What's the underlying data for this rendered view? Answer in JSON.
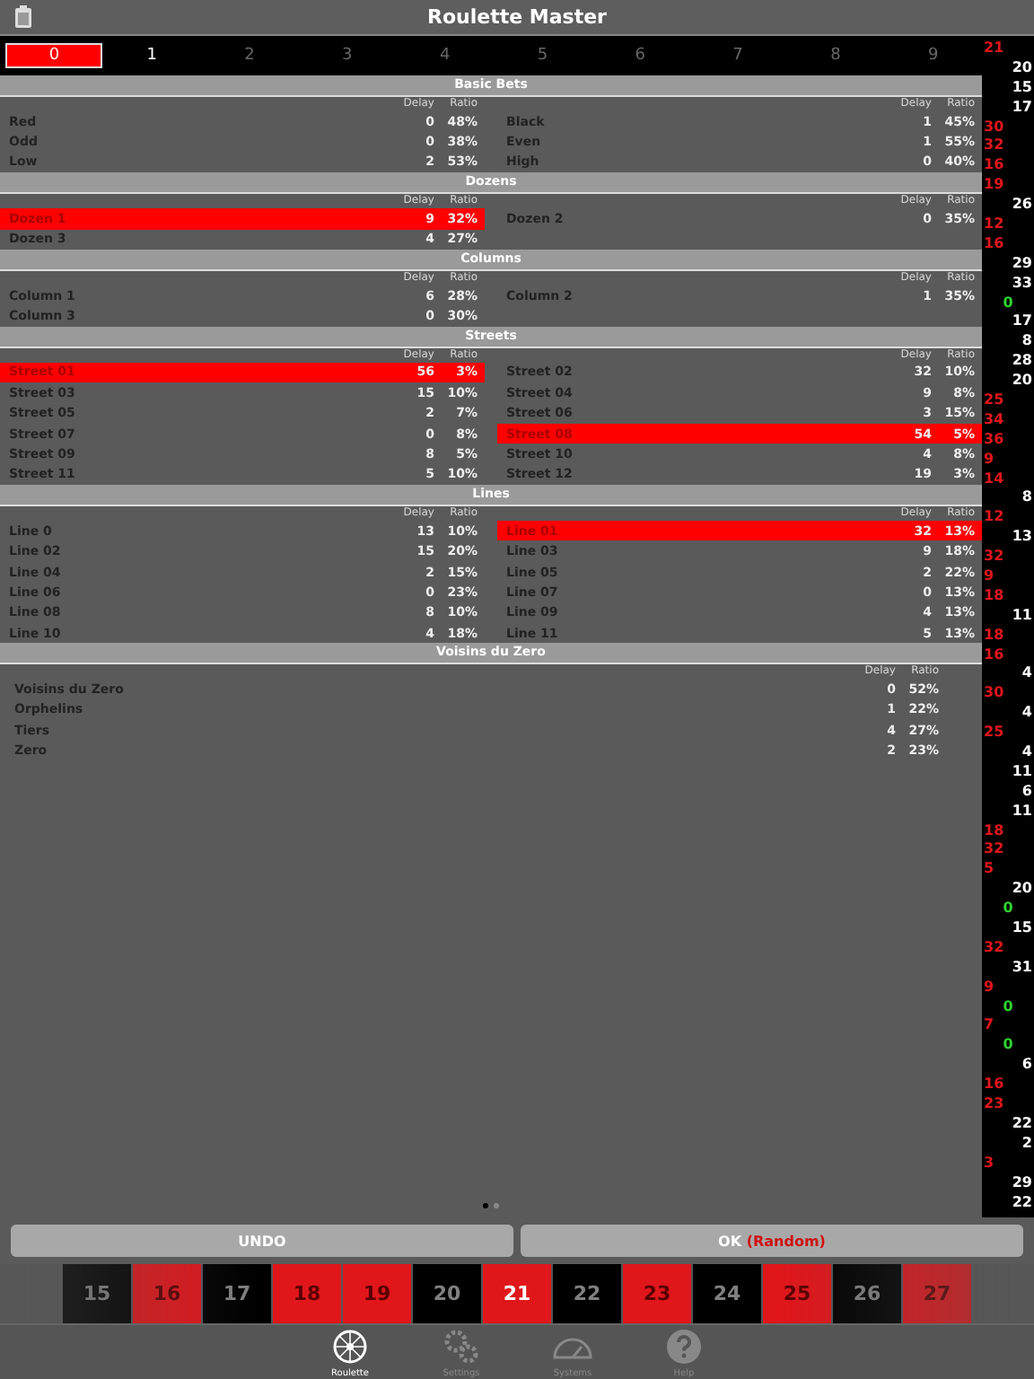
{
  "window": {
    "title": "Roulette Master"
  },
  "digits": [
    {
      "label": "0",
      "selected": true,
      "enabled": true
    },
    {
      "label": "1",
      "selected": false,
      "enabled": true
    },
    {
      "label": "2",
      "selected": false,
      "enabled": false
    },
    {
      "label": "3",
      "selected": false,
      "enabled": false
    },
    {
      "label": "4",
      "selected": false,
      "enabled": false
    },
    {
      "label": "5",
      "selected": false,
      "enabled": false
    },
    {
      "label": "6",
      "selected": false,
      "enabled": false
    },
    {
      "label": "7",
      "selected": false,
      "enabled": false
    },
    {
      "label": "8",
      "selected": false,
      "enabled": false
    },
    {
      "label": "9",
      "selected": false,
      "enabled": false
    }
  ],
  "sections": [
    {
      "title": "Basic Bets",
      "kind": "two_column",
      "columns": [
        {
          "delay_label": "Delay",
          "ratio_label": "Ratio",
          "rows": [
            {
              "label": "Red",
              "delay": "0",
              "ratio": "48%",
              "highlighted": false
            },
            {
              "label": "Odd",
              "delay": "0",
              "ratio": "38%",
              "highlighted": false
            },
            {
              "label": "Low",
              "delay": "2",
              "ratio": "53%",
              "highlighted": false
            }
          ]
        },
        {
          "delay_label": "Delay",
          "ratio_label": "Ratio",
          "rows": [
            {
              "label": "Black",
              "delay": "1",
              "ratio": "45%",
              "highlighted": false
            },
            {
              "label": "Even",
              "delay": "1",
              "ratio": "55%",
              "highlighted": false
            },
            {
              "label": "High",
              "delay": "0",
              "ratio": "40%",
              "highlighted": false
            }
          ]
        }
      ]
    },
    {
      "title": "Dozens",
      "kind": "two_column",
      "columns": [
        {
          "delay_label": "Delay",
          "ratio_label": "Ratio",
          "rows": [
            {
              "label": "Dozen 1",
              "delay": "9",
              "ratio": "32%",
              "highlighted": true
            },
            {
              "label": "Dozen 3",
              "delay": "4",
              "ratio": "27%",
              "highlighted": false
            }
          ]
        },
        {
          "delay_label": "Delay",
          "ratio_label": "Ratio",
          "rows": [
            {
              "label": "Dozen 2",
              "delay": "0",
              "ratio": "35%",
              "highlighted": false
            }
          ]
        }
      ]
    },
    {
      "title": "Columns",
      "kind": "two_column",
      "columns": [
        {
          "delay_label": "Delay",
          "ratio_label": "Ratio",
          "rows": [
            {
              "label": "Column 1",
              "delay": "6",
              "ratio": "28%",
              "highlighted": false
            },
            {
              "label": "Column 3",
              "delay": "0",
              "ratio": "30%",
              "highlighted": false
            }
          ]
        },
        {
          "delay_label": "Delay",
          "ratio_label": "Ratio",
          "rows": [
            {
              "label": "Column 2",
              "delay": "1",
              "ratio": "35%",
              "highlighted": false
            }
          ]
        }
      ]
    },
    {
      "title": "Streets",
      "kind": "two_column",
      "columns": [
        {
          "delay_label": "Delay",
          "ratio_label": "Ratio",
          "rows": [
            {
              "label": "Street 01",
              "delay": "56",
              "ratio": "3%",
              "highlighted": true
            },
            {
              "label": "Street 03",
              "delay": "15",
              "ratio": "10%",
              "highlighted": false
            },
            {
              "label": "Street 05",
              "delay": "2",
              "ratio": "7%",
              "highlighted": false
            },
            {
              "label": "Street 07",
              "delay": "0",
              "ratio": "8%",
              "highlighted": false
            },
            {
              "label": "Street 09",
              "delay": "8",
              "ratio": "5%",
              "highlighted": false
            },
            {
              "label": "Street 11",
              "delay": "5",
              "ratio": "10%",
              "highlighted": false
            }
          ]
        },
        {
          "delay_label": "Delay",
          "ratio_label": "Ratio",
          "rows": [
            {
              "label": "Street 02",
              "delay": "32",
              "ratio": "10%",
              "highlighted": false
            },
            {
              "label": "Street 04",
              "delay": "9",
              "ratio": "8%",
              "highlighted": false
            },
            {
              "label": "Street 06",
              "delay": "3",
              "ratio": "15%",
              "highlighted": false
            },
            {
              "label": "Street 08",
              "delay": "54",
              "ratio": "5%",
              "highlighted": true
            },
            {
              "label": "Street 10",
              "delay": "4",
              "ratio": "8%",
              "highlighted": false
            },
            {
              "label": "Street 12",
              "delay": "19",
              "ratio": "3%",
              "highlighted": false
            }
          ]
        }
      ]
    },
    {
      "title": "Lines",
      "kind": "two_column",
      "columns": [
        {
          "delay_label": "Delay",
          "ratio_label": "Ratio",
          "rows": [
            {
              "label": "Line 0",
              "delay": "13",
              "ratio": "10%",
              "highlighted": false
            },
            {
              "label": "Line 02",
              "delay": "15",
              "ratio": "20%",
              "highlighted": false
            },
            {
              "label": "Line 04",
              "delay": "2",
              "ratio": "15%",
              "highlighted": false
            },
            {
              "label": "Line 06",
              "delay": "0",
              "ratio": "23%",
              "highlighted": false
            },
            {
              "label": "Line 08",
              "delay": "8",
              "ratio": "10%",
              "highlighted": false
            },
            {
              "label": "Line 10",
              "delay": "4",
              "ratio": "18%",
              "highlighted": false
            }
          ]
        },
        {
          "delay_label": "Delay",
          "ratio_label": "Ratio",
          "rows": [
            {
              "label": "Line 01",
              "delay": "32",
              "ratio": "13%",
              "highlighted": true
            },
            {
              "label": "Line 03",
              "delay": "9",
              "ratio": "18%",
              "highlighted": false
            },
            {
              "label": "Line 05",
              "delay": "2",
              "ratio": "22%",
              "highlighted": false
            },
            {
              "label": "Line 07",
              "delay": "0",
              "ratio": "13%",
              "highlighted": false
            },
            {
              "label": "Line 09",
              "delay": "4",
              "ratio": "13%",
              "highlighted": false
            },
            {
              "label": "Line 11",
              "delay": "5",
              "ratio": "13%",
              "highlighted": false
            }
          ]
        }
      ]
    },
    {
      "title": "Voisins du Zero",
      "kind": "single_column",
      "columns": [
        {
          "delay_label": "Delay",
          "ratio_label": "Ratio",
          "rows": [
            {
              "label": "Voisins du Zero",
              "delay": "0",
              "ratio": "52%",
              "highlighted": false
            },
            {
              "label": "Orphelins",
              "delay": "1",
              "ratio": "22%",
              "highlighted": false
            },
            {
              "label": "Tiers",
              "delay": "4",
              "ratio": "27%",
              "highlighted": false
            },
            {
              "label": "Zero",
              "delay": "2",
              "ratio": "23%",
              "highlighted": false
            }
          ]
        }
      ]
    }
  ],
  "history": [
    {
      "number": "21",
      "kind": "red"
    },
    {
      "number": "20",
      "kind": "black"
    },
    {
      "number": "15",
      "kind": "black"
    },
    {
      "number": "17",
      "kind": "black"
    },
    {
      "number": "30",
      "kind": "red"
    },
    {
      "number": "32",
      "kind": "red"
    },
    {
      "number": "16",
      "kind": "red"
    },
    {
      "number": "19",
      "kind": "red"
    },
    {
      "number": "26",
      "kind": "black"
    },
    {
      "number": "12",
      "kind": "red"
    },
    {
      "number": "16",
      "kind": "red"
    },
    {
      "number": "29",
      "kind": "black"
    },
    {
      "number": "33",
      "kind": "black"
    },
    {
      "number": "0",
      "kind": "green"
    },
    {
      "number": "17",
      "kind": "black"
    },
    {
      "number": "8",
      "kind": "black"
    },
    {
      "number": "28",
      "kind": "black"
    },
    {
      "number": "20",
      "kind": "black"
    },
    {
      "number": "25",
      "kind": "red"
    },
    {
      "number": "34",
      "kind": "red"
    },
    {
      "number": "36",
      "kind": "red"
    },
    {
      "number": "9",
      "kind": "red"
    },
    {
      "number": "14",
      "kind": "red"
    },
    {
      "number": "8",
      "kind": "black"
    },
    {
      "number": "12",
      "kind": "red"
    },
    {
      "number": "13",
      "kind": "black"
    },
    {
      "number": "32",
      "kind": "red"
    },
    {
      "number": "9",
      "kind": "red"
    },
    {
      "number": "18",
      "kind": "red"
    },
    {
      "number": "11",
      "kind": "black"
    },
    {
      "number": "18",
      "kind": "red"
    },
    {
      "number": "16",
      "kind": "red"
    },
    {
      "number": "4",
      "kind": "black"
    },
    {
      "number": "30",
      "kind": "red"
    },
    {
      "number": "4",
      "kind": "black"
    },
    {
      "number": "25",
      "kind": "red"
    },
    {
      "number": "4",
      "kind": "black"
    },
    {
      "number": "11",
      "kind": "black"
    },
    {
      "number": "6",
      "kind": "black"
    },
    {
      "number": "11",
      "kind": "black"
    },
    {
      "number": "18",
      "kind": "red"
    },
    {
      "number": "32",
      "kind": "red"
    },
    {
      "number": "5",
      "kind": "red"
    },
    {
      "number": "20",
      "kind": "black"
    },
    {
      "number": "0",
      "kind": "green"
    },
    {
      "number": "15",
      "kind": "black"
    },
    {
      "number": "32",
      "kind": "red"
    },
    {
      "number": "31",
      "kind": "black"
    },
    {
      "number": "9",
      "kind": "red"
    },
    {
      "number": "0",
      "kind": "green"
    },
    {
      "number": "7",
      "kind": "red"
    },
    {
      "number": "0",
      "kind": "green"
    },
    {
      "number": "6",
      "kind": "black"
    },
    {
      "number": "16",
      "kind": "red"
    },
    {
      "number": "23",
      "kind": "red"
    },
    {
      "number": "22",
      "kind": "black"
    },
    {
      "number": "2",
      "kind": "black"
    },
    {
      "number": "3",
      "kind": "red"
    },
    {
      "number": "29",
      "kind": "black"
    },
    {
      "number": "22",
      "kind": "black"
    }
  ],
  "pager": [
    {
      "selected": true
    },
    {
      "selected": false
    }
  ],
  "buttons": {
    "undo": "UNDO",
    "ok": "OK",
    "ok_note": "(Random)"
  },
  "number_strip": [
    {
      "number": "15",
      "kind": "black",
      "selected": false
    },
    {
      "number": "16",
      "kind": "red",
      "selected": false
    },
    {
      "number": "17",
      "kind": "black",
      "selected": false
    },
    {
      "number": "18",
      "kind": "red",
      "selected": false
    },
    {
      "number": "19",
      "kind": "red",
      "selected": false
    },
    {
      "number": "20",
      "kind": "black",
      "selected": false
    },
    {
      "number": "21",
      "kind": "red",
      "selected": true
    },
    {
      "number": "22",
      "kind": "black",
      "selected": false
    },
    {
      "number": "23",
      "kind": "red",
      "selected": false
    },
    {
      "number": "24",
      "kind": "black",
      "selected": false
    },
    {
      "number": "25",
      "kind": "red",
      "selected": false
    },
    {
      "number": "26",
      "kind": "black",
      "selected": false
    },
    {
      "number": "27",
      "kind": "red",
      "selected": false
    }
  ],
  "tabs": [
    {
      "label": "Roulette",
      "selected": true
    },
    {
      "label": "Settings",
      "selected": false
    },
    {
      "label": "Systems",
      "selected": false
    },
    {
      "label": "Help",
      "selected": false
    }
  ]
}
